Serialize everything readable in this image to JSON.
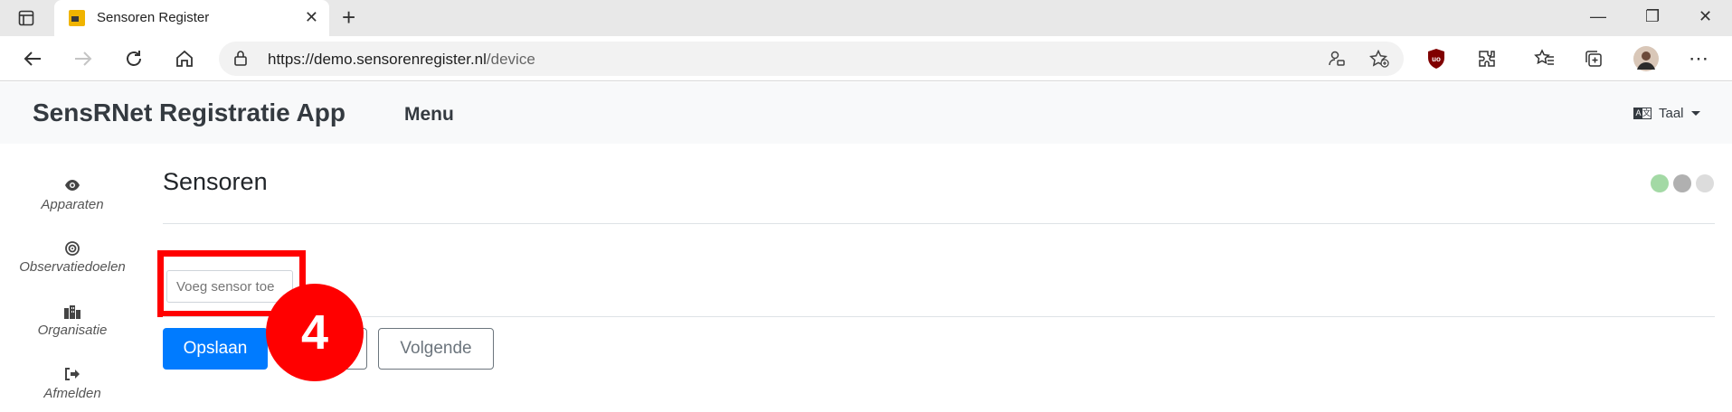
{
  "browser": {
    "tab_title": "Sensoren Register",
    "url_host": "https://demo.sensorenregister.nl",
    "url_path": "/device",
    "win_minimize": "—",
    "win_restore": "❐",
    "win_close": "✕"
  },
  "app": {
    "brand": "SensRNet Registratie App",
    "menu": "Menu",
    "language": "Taal"
  },
  "sidebar": {
    "items": [
      {
        "label": "Apparaten",
        "icon": "eye-icon"
      },
      {
        "label": "Observatiedoelen",
        "icon": "target-icon"
      },
      {
        "label": "Organisatie",
        "icon": "building-icon"
      },
      {
        "label": "Afmelden",
        "icon": "sign-out-icon"
      }
    ]
  },
  "main": {
    "title": "Sensoren",
    "progress_dots": [
      "#a3d9a5",
      "#b0b0b0",
      "#dcdcdc"
    ],
    "sensor_input_placeholder": "Voeg sensor toe",
    "save_label": "Opslaan",
    "next_label": "Volgende"
  },
  "annotation": {
    "step_number": "4",
    "color": "#ff0000"
  }
}
